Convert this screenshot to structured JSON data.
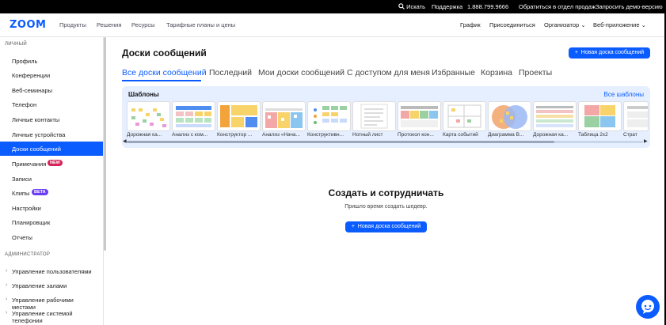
{
  "topbar": {
    "search": "Искать",
    "support": "Поддержка",
    "phone": "1.888.799.9666",
    "contact_sales": "Обратиться в отдел продаж",
    "request_demo": "Запросить демо-версию"
  },
  "nav": {
    "logo": "zoom",
    "links": [
      "Продукты",
      "Решения",
      "Ресурсы",
      "Тарифные планы и цены"
    ],
    "schedule": "График",
    "join": "Присоединиться",
    "host": "Организатор",
    "web_app": "Веб-приложение"
  },
  "sidebar": {
    "personal_header": "ЛИЧНЫЙ",
    "items": [
      {
        "label": "Профиль"
      },
      {
        "label": "Конференции"
      },
      {
        "label": "Веб-семинары"
      },
      {
        "label": "Телефон"
      },
      {
        "label": "Личные контакты"
      },
      {
        "label": "Личные устройства"
      },
      {
        "label": "Доски сообщений"
      },
      {
        "label": "Примечания",
        "badge": "NEW"
      },
      {
        "label": "Записи"
      },
      {
        "label": "Клипы",
        "badge": "BETA"
      },
      {
        "label": "Настройки"
      },
      {
        "label": "Планировщик"
      },
      {
        "label": "Отчеты"
      }
    ],
    "admin_header": "АДМИНИСТРАТОР",
    "admin_items": [
      {
        "label": "Управление пользователями"
      },
      {
        "label": "Управление залами"
      },
      {
        "label": "Управление рабочими местами"
      },
      {
        "label": "Управление системой телефонии"
      }
    ]
  },
  "main": {
    "title": "Доски сообщений",
    "new_button": "Новая доска сообщений",
    "tabs": [
      "Все доски сообщений",
      "Последний",
      "Мои доски сообщений",
      "С доступом для меня",
      "Избранные",
      "Корзина",
      "Проекты"
    ],
    "templates": {
      "title": "Шаблоны",
      "all_link": "Все шаблоны",
      "cards": [
        {
          "label": "Дорожная ка..."
        },
        {
          "label": "Анализ с ком..."
        },
        {
          "label": "Конструктор ..."
        },
        {
          "label": "Анализ «Нача..."
        },
        {
          "label": "Конструктивн..."
        },
        {
          "label": "Нотный лист"
        },
        {
          "label": "Протокол кон..."
        },
        {
          "label": "Карта событий"
        },
        {
          "label": "Диаграмма В..."
        },
        {
          "label": "Дорожная ка..."
        },
        {
          "label": "Таблица 2x2"
        },
        {
          "label": "Страт"
        }
      ]
    },
    "empty": {
      "title": "Создать и сотрудничать",
      "subtitle": "Пришло время создать шедевр.",
      "button": "Новая доска сообщений"
    }
  },
  "colors": {
    "accent": "#0b5cff",
    "template_bg": "#e5efff"
  }
}
